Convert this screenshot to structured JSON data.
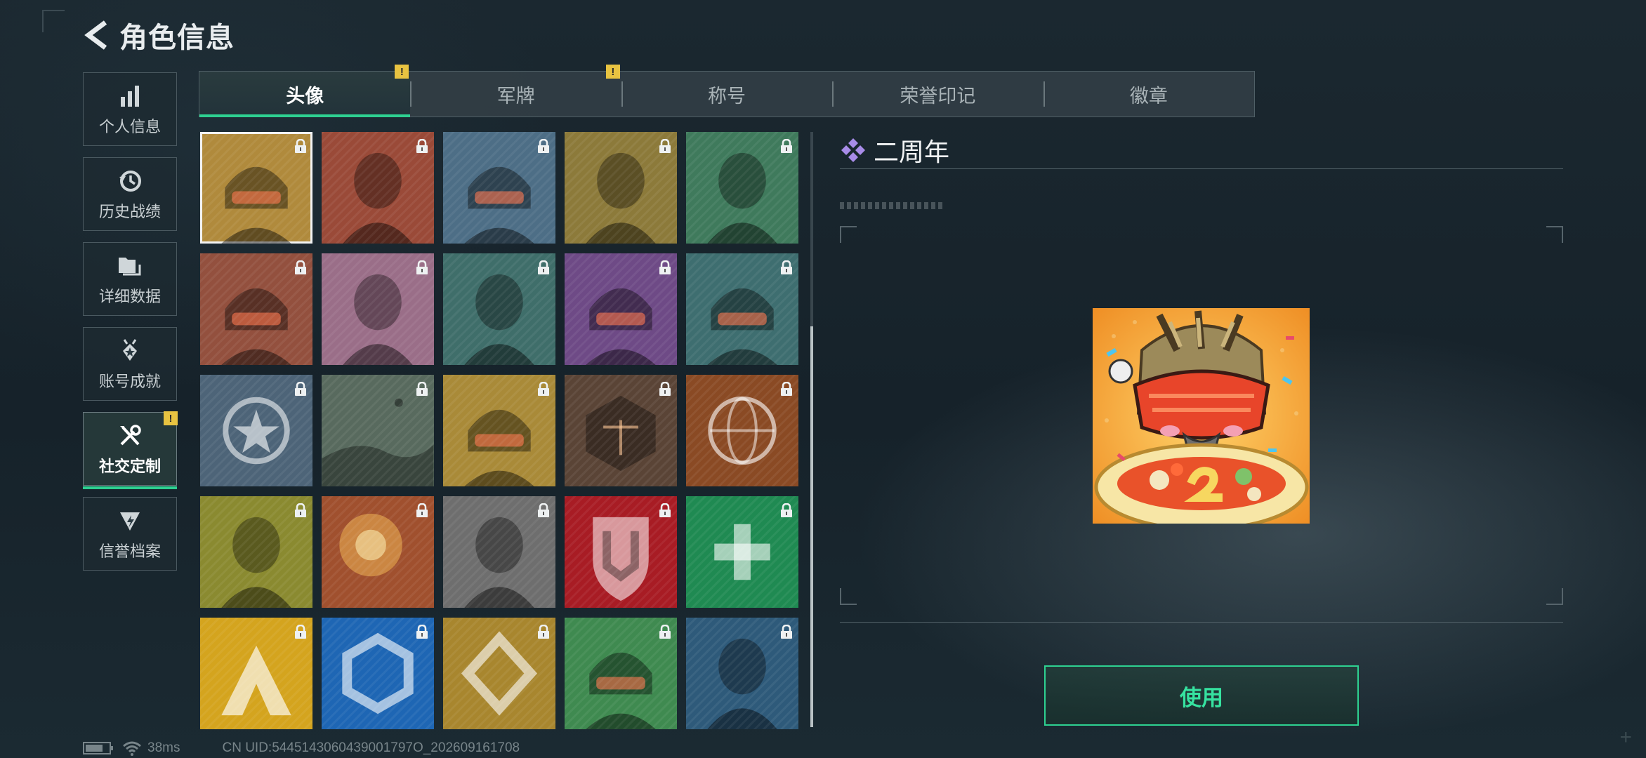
{
  "header": {
    "title": "角色信息",
    "back_icon": "back-arrow-icon"
  },
  "nav": {
    "items": [
      {
        "label": "个人信息",
        "icon": "bar-chart-icon",
        "active": false,
        "alert": false
      },
      {
        "label": "历史战绩",
        "icon": "history-clock-icon",
        "active": false,
        "alert": false
      },
      {
        "label": "详细数据",
        "icon": "folders-icon",
        "active": false,
        "alert": false
      },
      {
        "label": "账号成就",
        "icon": "achievement-medal-icon",
        "active": false,
        "alert": false
      },
      {
        "label": "社交定制",
        "icon": "tools-icon",
        "active": true,
        "alert": true
      },
      {
        "label": "信誉档案",
        "icon": "credit-emblem-icon",
        "active": false,
        "alert": false
      }
    ]
  },
  "tabs": [
    {
      "label": "头像",
      "active": true,
      "alert": true
    },
    {
      "label": "军牌",
      "active": false,
      "alert": true
    },
    {
      "label": "称号",
      "active": false,
      "alert": false
    },
    {
      "label": "荣誉印记",
      "active": false,
      "alert": false
    },
    {
      "label": "徽章",
      "active": false,
      "alert": false
    }
  ],
  "alert_mark": "!",
  "avatars": [
    {
      "kind": "helmet-noodles",
      "bg": "#b08a3c",
      "locked": true,
      "selected": true
    },
    {
      "kind": "man-cap",
      "bg": "#9a4a38",
      "locked": true
    },
    {
      "kind": "pilot",
      "bg": "#4d6e86",
      "locked": true
    },
    {
      "kind": "bald-headset",
      "bg": "#8c7a3a",
      "locked": true
    },
    {
      "kind": "man-headset",
      "bg": "#3f7a5c",
      "locked": true
    },
    {
      "kind": "soldier-goggles",
      "bg": "#93503e",
      "locked": true
    },
    {
      "kind": "white-hair",
      "bg": "#9a6e88",
      "locked": true
    },
    {
      "kind": "man-glasses",
      "bg": "#3f6e6a",
      "locked": true
    },
    {
      "kind": "woman-visor",
      "bg": "#6e4a86",
      "locked": true
    },
    {
      "kind": "masked-soldier",
      "bg": "#3e6e70",
      "locked": true
    },
    {
      "kind": "star-gear-emblem",
      "bg": "#4d6478",
      "locked": true
    },
    {
      "kind": "landscape-heli",
      "bg": "#586a5e",
      "locked": true
    },
    {
      "kind": "mascot-noodles",
      "bg": "#a98a38",
      "locked": true
    },
    {
      "kind": "scales-emblem",
      "bg": "#5a4436",
      "locked": true
    },
    {
      "kind": "eri-globe",
      "bg": "#8a4a24",
      "locked": true
    },
    {
      "kind": "man-glasses-olive",
      "bg": "#8a8a30",
      "locked": true
    },
    {
      "kind": "explosion",
      "bg": "#a0502e",
      "locked": true
    },
    {
      "kind": "gunman-gray",
      "bg": "#6e6e6e",
      "locked": true
    },
    {
      "kind": "shield-logo-red",
      "bg": "#a81c24",
      "locked": true
    },
    {
      "kind": "medic-cross-green",
      "bg": "#1f8a52",
      "locked": true
    },
    {
      "kind": "a-logo-yellow",
      "bg": "#d4a41e",
      "locked": true
    },
    {
      "kind": "hex-logo-blue",
      "bg": "#1e66b4",
      "locked": true
    },
    {
      "kind": "diamond-logo-gold",
      "bg": "#a8862e",
      "locked": true
    },
    {
      "kind": "soldier-woman-green",
      "bg": "#3f8a50",
      "locked": true
    },
    {
      "kind": "man-blue",
      "bg": "#2e5a7a",
      "locked": true
    }
  ],
  "detail": {
    "title": "二周年",
    "title_icon": "diamond-cluster-icon",
    "use_label": "使用"
  },
  "status_bar": {
    "ping": "38ms",
    "uid": "CN UID:5445143060439001797O_202609161708",
    "wifi_icon": "wifi-icon",
    "battery_icon": "battery-icon"
  },
  "colors": {
    "accent": "#2ed191",
    "alert": "#e8c341",
    "purple": "#a88ce8"
  }
}
